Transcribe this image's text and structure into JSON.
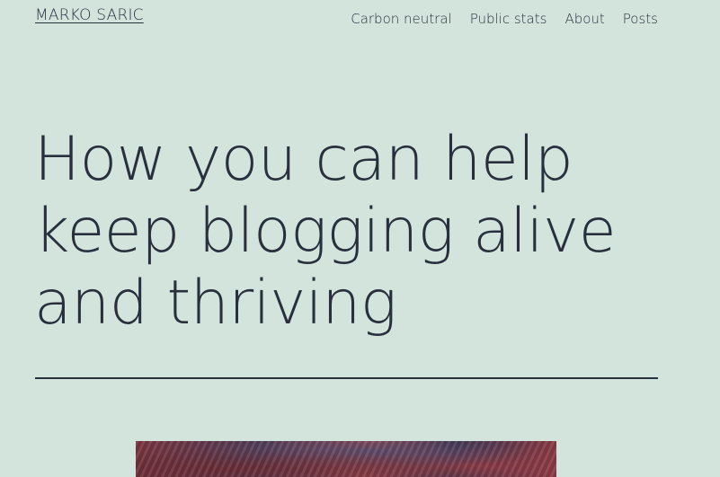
{
  "header": {
    "site_title": "MARKO SARIC",
    "nav": [
      {
        "label": "Carbon neutral"
      },
      {
        "label": "Public stats"
      },
      {
        "label": "About"
      },
      {
        "label": "Posts"
      }
    ]
  },
  "main": {
    "title_lines": [
      "How you can help",
      "keep blogging alive",
      "and thriving"
    ]
  },
  "colors": {
    "background": "#d3e4dd",
    "text": "#28303d"
  }
}
